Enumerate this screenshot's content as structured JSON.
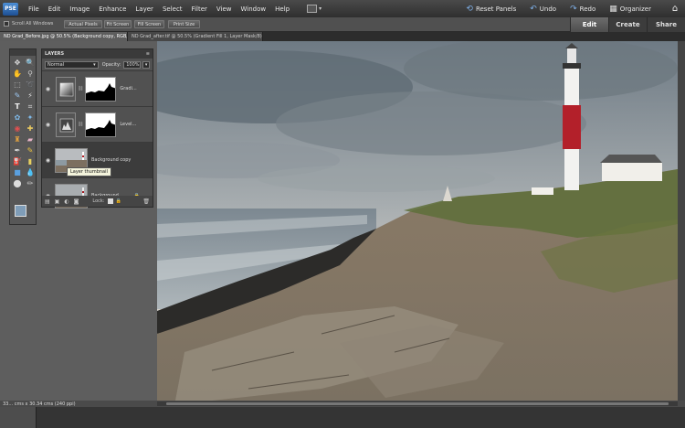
{
  "app": {
    "logo": "PSE",
    "menu": [
      "File",
      "Edit",
      "Image",
      "Enhance",
      "Layer",
      "Select",
      "Filter",
      "View",
      "Window",
      "Help"
    ],
    "right_tools": {
      "reset_panels": "Reset Panels",
      "undo": "Undo",
      "redo": "Redo",
      "organizer": "Organizer"
    }
  },
  "options_bar": {
    "scroll_all_windows": "Scroll All Windows",
    "buttons": [
      "Actual Pixels",
      "Fit Screen",
      "Fill Screen",
      "Print Size"
    ]
  },
  "mode_tabs": {
    "edit": "Edit",
    "create": "Create",
    "share": "Share",
    "active": "edit"
  },
  "doc_tabs": [
    "ND Grad_Before.jpg @ 50.5% (Background copy, RGB/8*) *",
    "ND Grad_after.tif @ 50.5% (Gradient Fill 1, Layer Mask/8) *"
  ],
  "layers_panel": {
    "title": "LAYERS",
    "blend_mode": "Normal",
    "opacity_label": "Opacity:",
    "opacity_value": "100%",
    "layers": [
      {
        "name": "Gradi...",
        "type": "gradient-adjustment"
      },
      {
        "name": "Level...",
        "type": "levels-adjustment"
      },
      {
        "name": "Background copy",
        "type": "image",
        "selected": true
      },
      {
        "name": "Background",
        "type": "image",
        "locked": true
      }
    ],
    "tooltip": "Layer thumbnail",
    "lock_label": "Lock:"
  },
  "status": {
    "text": "33... cms x 30.34 cms (240 ppi)"
  },
  "colors": {
    "accent": "#4c8fd6",
    "foreground_swatch": "#7f9db8",
    "background_swatch": "#000000"
  },
  "icons": {
    "toolbox": [
      "move-tool",
      "zoom-tool",
      "hand-tool",
      "eyedropper-tool",
      "marquee-tool",
      "lasso-tool",
      "quick-selection-tool",
      "magic-wand-tool",
      "type-tool",
      "crop-tool",
      "recompose-tool",
      "cookie-cutter-tool",
      "red-eye-tool",
      "spot-healing-tool",
      "clone-stamp-tool",
      "eraser-tool",
      "brush-tool",
      "smart-brush-tool",
      "paint-bucket-tool",
      "gradient-tool",
      "shape-tool",
      "blur-tool",
      "sponge-tool",
      "pencil-tool",
      "custom-shape-tool"
    ]
  }
}
